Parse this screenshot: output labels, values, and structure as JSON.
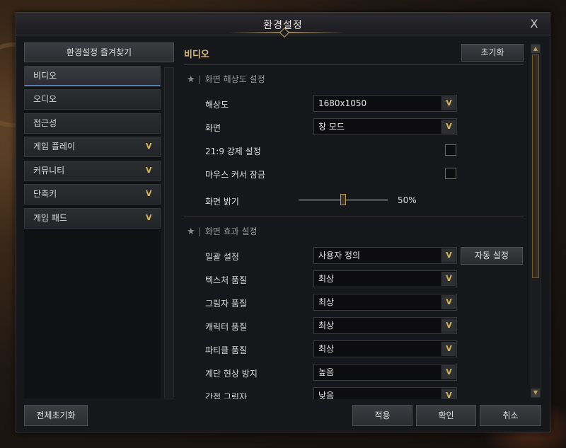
{
  "window": {
    "title": "환경설정",
    "close_label": "X"
  },
  "left_panel": {
    "favorites_label": "환경설정 즐겨찾기",
    "items": [
      {
        "label": "비디오",
        "active": true,
        "expandable": false
      },
      {
        "label": "오디오",
        "active": false,
        "expandable": false
      },
      {
        "label": "접근성",
        "active": false,
        "expandable": false
      },
      {
        "label": "게임 플레이",
        "active": false,
        "expandable": true
      },
      {
        "label": "커뮤니티",
        "active": false,
        "expandable": true
      },
      {
        "label": "단축키",
        "active": false,
        "expandable": true
      },
      {
        "label": "게임 패드",
        "active": false,
        "expandable": true
      }
    ]
  },
  "main": {
    "section_title": "비디오",
    "reset_label": "초기화",
    "resolution_group": {
      "title": "화면 해상도 설정",
      "resolution_label": "해상도",
      "resolution_value": "1680x1050",
      "screen_label": "화면",
      "screen_value": "창 모드",
      "force_219_label": "21:9 강제 설정",
      "force_219_checked": false,
      "cursor_lock_label": "마우스 커서 잠금",
      "cursor_lock_checked": false,
      "brightness_label": "화면 밝기",
      "brightness_value": "50%",
      "brightness_level": 0.5
    },
    "effects_group": {
      "title": "화면 효과 설정",
      "auto_label": "자동 설정",
      "rows": [
        {
          "label": "일괄 설정",
          "value": "사용자 정의"
        },
        {
          "label": "텍스처 품질",
          "value": "최상"
        },
        {
          "label": "그림자 품질",
          "value": "최상"
        },
        {
          "label": "캐릭터 품질",
          "value": "최상"
        },
        {
          "label": "파티클 품질",
          "value": "최상"
        },
        {
          "label": "계단 현상 방지",
          "value": "높음"
        },
        {
          "label": "간접 그림자",
          "value": "낮음"
        }
      ]
    }
  },
  "footer": {
    "reset_all_label": "전체초기화",
    "apply_label": "적용",
    "confirm_label": "확인",
    "cancel_label": "취소"
  },
  "colors": {
    "accent_gold": "#d8b45a",
    "active_underline": "#5e7fae"
  }
}
